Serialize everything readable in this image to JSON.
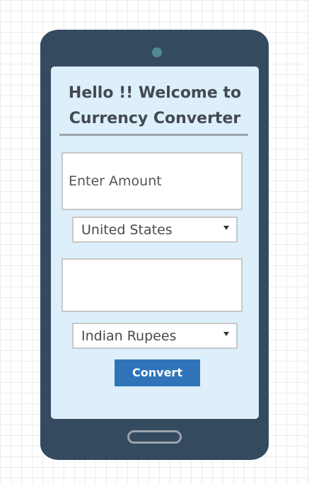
{
  "screen": {
    "title_line1": "Hello !! Welcome to",
    "title_line2": "Currency Converter"
  },
  "amount": {
    "placeholder": "Enter Amount",
    "value": ""
  },
  "from_currency": {
    "selected": "United States"
  },
  "result": {
    "value": ""
  },
  "to_currency": {
    "selected": "Indian Rupees"
  },
  "convert": {
    "label": "Convert"
  },
  "colors": {
    "phone_body": "#344a5f",
    "screen_bg": "#dceffa",
    "button_bg": "#2f74b8",
    "title_text": "#444a52"
  },
  "icons": {
    "camera": "camera-icon",
    "dropdown": "chevron-down-icon",
    "home": "home-button"
  }
}
